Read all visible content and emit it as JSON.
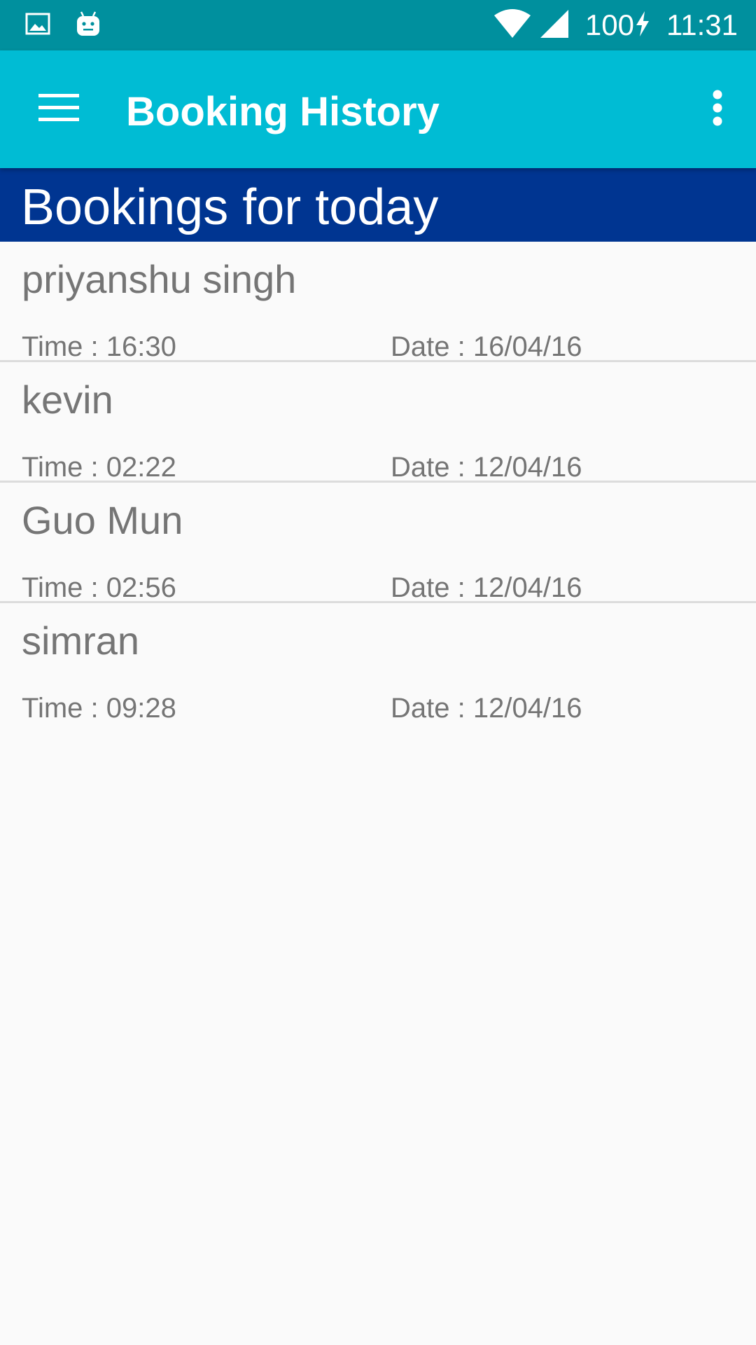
{
  "status_bar": {
    "battery": "100",
    "time": "11:31",
    "icons": [
      "image-icon",
      "android-icon",
      "wifi-icon",
      "signal-icon",
      "charging-icon"
    ]
  },
  "app_bar": {
    "title": "Booking History",
    "menu_icon": "hamburger-menu-icon",
    "overflow_icon": "more-vert-icon",
    "color": "#00bcd4"
  },
  "section": {
    "title": "Bookings for today",
    "color": "#003591"
  },
  "bookings": [
    {
      "name": "priyanshu singh",
      "time": "Time : 16:30",
      "date": "Date : 16/04/16"
    },
    {
      "name": "kevin",
      "time": "Time : 02:22",
      "date": "Date : 12/04/16"
    },
    {
      "name": "Guo Mun",
      "time": "Time : 02:56",
      "date": "Date : 12/04/16"
    },
    {
      "name": "simran",
      "time": "Time : 09:28",
      "date": "Date : 12/04/16"
    }
  ],
  "colors": {
    "status_bar": "#00909e",
    "background": "#fafafa",
    "text_secondary": "#757575",
    "divider": "#dcdcdc"
  }
}
